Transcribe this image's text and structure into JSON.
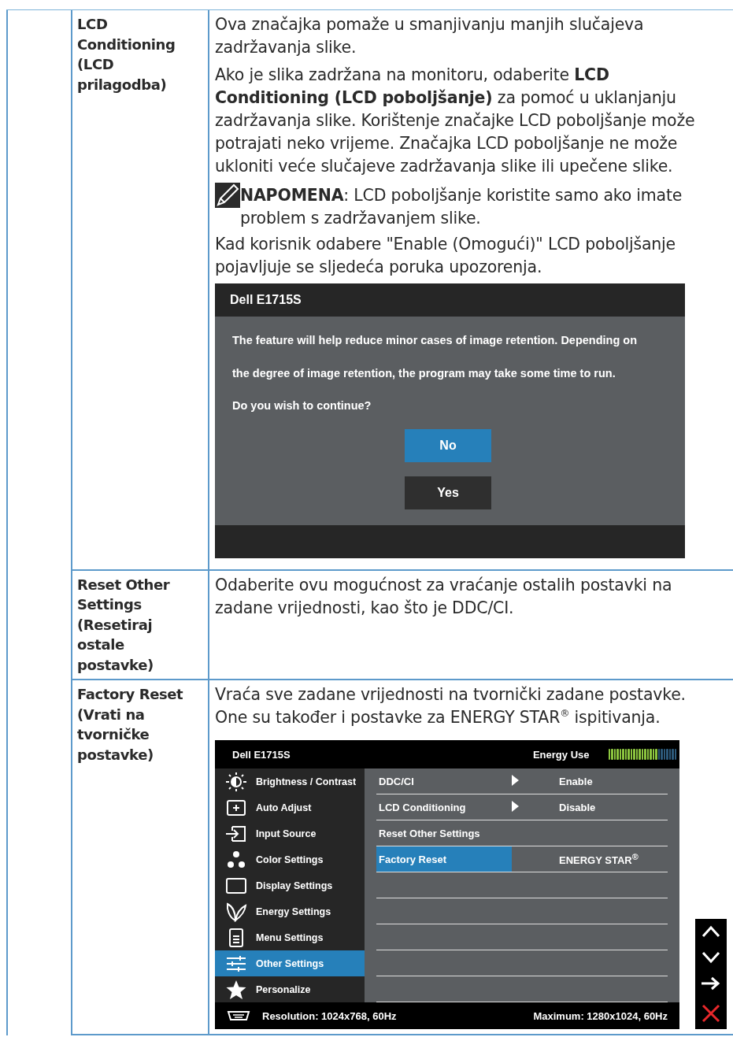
{
  "rows": [
    {
      "label": "LCD Conditioning (LCD prilagodba)",
      "blocks": [
        {
          "kind": "paragraph",
          "text": "Ova značajka pomaže u smanjivanju manjih slučajeva zadržavanja slike."
        },
        {
          "kind": "paragraph",
          "text": "Ako je slika zadržana na monitoru, odaberite **LCD Conditioning (LCD poboljšanje)** za pomoć u uklanjanju zadržavanja slike. Korištenje značajke LCD poboljšanje može potrajati neko vrijeme. Značajka LCD poboljšanje ne može ukloniti veće slučajeve zadržavanja slike ili upečene slike."
        },
        {
          "kind": "note",
          "text": "**NAPOMENA**: LCD poboljšanje koristite samo ako imate problem s zadržavanjem slike."
        },
        {
          "kind": "paragraph",
          "text": "Kad korisnik odabere \"Enable (Omogući)\" LCD poboljšanje pojavljuje se sljedeća poruka upozorenja."
        },
        {
          "kind": "dialog",
          "title": "Dell E1715S",
          "lines": [
            "The feature will help reduce minor cases of image retention. Depending on",
            "the degree of image retention, the program may take some time to run.",
            "Do you wish to continue?"
          ],
          "buttons": [
            {
              "label": "No",
              "selected": true
            },
            {
              "label": "Yes",
              "selected": false
            }
          ]
        }
      ]
    },
    {
      "label": "Reset Other Settings (Resetiraj ostale postavke)",
      "blocks": [
        {
          "kind": "paragraph",
          "text": "Odaberite ovu mogućnost za vraćanje ostalih postavki na zadane vrijednosti, kao što je DDC/CI."
        }
      ]
    },
    {
      "label": "Factory Reset (Vrati na tvorničke postavke)",
      "blocks": [
        {
          "kind": "paragraph",
          "text": "Vraća sve zadane vrijednosti na tvornički zadane postavke. One su također i postavke za ENERGY STAR$^{®}$ ispitivanja."
        },
        {
          "kind": "osd",
          "title": "Dell E1715S",
          "energy_label": "Energy Use",
          "energy": {
            "level": 0.72
          },
          "menu": [
            {
              "label": "Brightness / Contrast",
              "selected": false
            },
            {
              "label": "Auto Adjust",
              "selected": false
            },
            {
              "label": "Input Source",
              "selected": false
            },
            {
              "label": "Color Settings",
              "selected": false
            },
            {
              "label": "Display Settings",
              "selected": false
            },
            {
              "label": "Energy Settings",
              "selected": false
            },
            {
              "label": "Menu Settings",
              "selected": false
            },
            {
              "label": "Other Settings",
              "selected": true
            },
            {
              "label": "Personalize",
              "selected": false
            }
          ],
          "submenu": [
            {
              "label": "DDC/CI",
              "submenu": true,
              "value": "Enable",
              "selected": false
            },
            {
              "label": "LCD Conditioning",
              "submenu": true,
              "value": "Disable",
              "selected": false
            },
            {
              "label": "Reset Other Settings",
              "submenu": false,
              "selected": false
            },
            {
              "label": "Factory Reset",
              "submenu": false,
              "value": "ENERGY STAR$^{®}$",
              "selected": true
            }
          ],
          "resolution": "Resolution: 1024x768, 60Hz",
          "maximum": "Maximum: 1280x1024, 60Hz"
        }
      ]
    }
  ]
}
